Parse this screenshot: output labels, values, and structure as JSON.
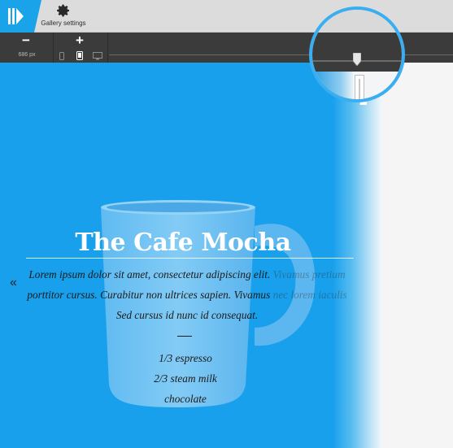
{
  "toolbar": {
    "logo_icon": "gallery-logo-icon",
    "gallery_settings": {
      "label": "Gallery settings",
      "icon": "gear-icon"
    }
  },
  "size_controls": {
    "zoom_out_label": "−",
    "zoom_in_label": "+",
    "width_value": "686 px",
    "devices": [
      "mobile-icon",
      "tablet-icon",
      "desktop-icon"
    ]
  },
  "slide": {
    "title": "The Cafe Mocha",
    "body_line1": "Lorem ipsum dolor sit amet, consectetur adipiscing elit.",
    "body_line1_faded": "Vivamus pretium",
    "body_line2": "porttitor cursus. Curabitur non ultrices sapien. Vivamus",
    "body_line2_faded": "nec lorem iaculis",
    "body_line3": "Sed cursus id nunc id consequat.",
    "ingredients": [
      "1/3 espresso",
      "2/3 steam milk",
      "chocolate"
    ],
    "prev_arrow": "«"
  },
  "colors": {
    "accent": "#1aa3e8",
    "stage_blue": "#18a0ec",
    "toolbar_dark": "#3b3b3b",
    "magnifier_ring": "#3aaef0"
  }
}
